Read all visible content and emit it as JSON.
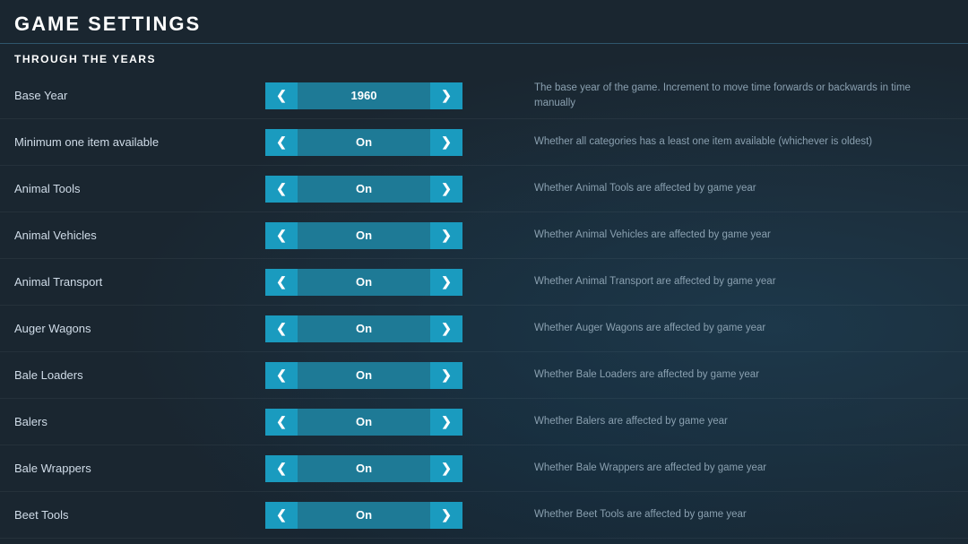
{
  "page": {
    "title": "GAME SETTINGS"
  },
  "section": {
    "label": "THROUGH THE YEARS"
  },
  "settings": [
    {
      "id": "base-year",
      "label": "Base Year",
      "value": "1960",
      "description": "The base year of the game. Increment to move time forwards or backwards in time manually"
    },
    {
      "id": "min-item",
      "label": "Minimum one item available",
      "value": "On",
      "description": "Whether all categories has a least one item available (whichever is oldest)"
    },
    {
      "id": "animal-tools",
      "label": "Animal Tools",
      "value": "On",
      "description": "Whether Animal Tools are affected by game year"
    },
    {
      "id": "animal-vehicles",
      "label": "Animal Vehicles",
      "value": "On",
      "description": "Whether Animal Vehicles are affected by game year"
    },
    {
      "id": "animal-transport",
      "label": "Animal Transport",
      "value": "On",
      "description": "Whether Animal Transport are affected by game year"
    },
    {
      "id": "auger-wagons",
      "label": "Auger Wagons",
      "value": "On",
      "description": "Whether Auger Wagons are affected by game year"
    },
    {
      "id": "bale-loaders",
      "label": "Bale Loaders",
      "value": "On",
      "description": "Whether Bale Loaders are affected by game year"
    },
    {
      "id": "balers",
      "label": "Balers",
      "value": "On",
      "description": "Whether Balers are affected by game year"
    },
    {
      "id": "bale-wrappers",
      "label": "Bale Wrappers",
      "value": "On",
      "description": "Whether Bale Wrappers are affected by game year"
    },
    {
      "id": "beet-tools",
      "label": "Beet Tools",
      "value": "On",
      "description": "Whether Beet Tools are affected by game year"
    }
  ]
}
